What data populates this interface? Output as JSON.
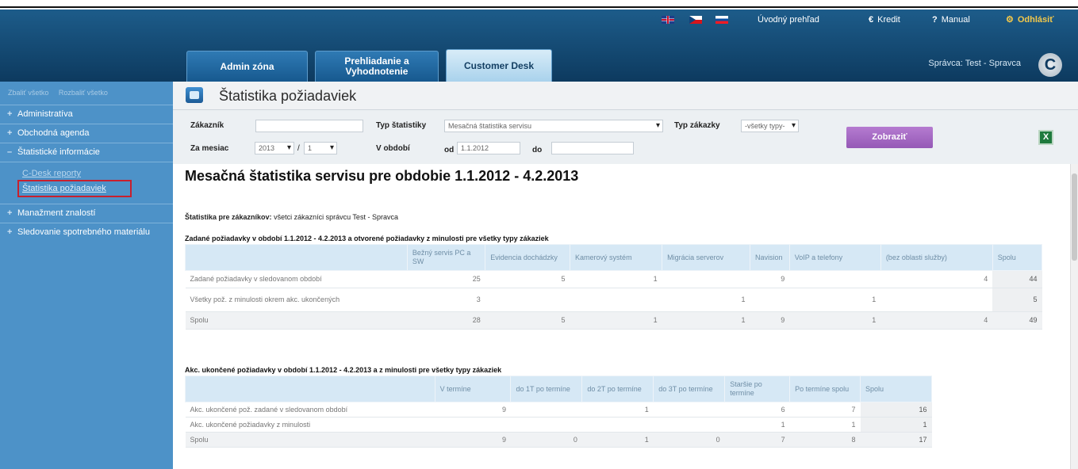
{
  "header": {
    "links": {
      "overview": "Úvodný prehľad",
      "credit": "Kredit",
      "manual": "Manual",
      "logout": "Odhlásiť"
    },
    "link_icons": {
      "credit": "€",
      "manual": "?",
      "logout": "⚙"
    },
    "tabs": [
      {
        "label": "Admin zóna"
      },
      {
        "label": "Prehliadanie a Vyhodnotenie"
      },
      {
        "label": "Customer Desk"
      }
    ],
    "user": "Správca: Test - Spravca",
    "logo": "C"
  },
  "sidebar": {
    "collapse_all": "Zbaliť všetko",
    "expand_all": "Rozbaliť všetko",
    "items": [
      {
        "mark": "+",
        "label": "Administratíva"
      },
      {
        "mark": "+",
        "label": "Obchodná agenda"
      },
      {
        "mark": "–",
        "label": "Štatistické informácie"
      },
      {
        "mark": "+",
        "label": "Manažment znalostí"
      },
      {
        "mark": "+",
        "label": "Sledovanie spotrebného materiálu"
      }
    ],
    "sub_items": [
      "C-Desk reporty",
      "Štatistika požiadaviek"
    ]
  },
  "page": {
    "title": "Štatistika požiadaviek"
  },
  "filters": {
    "customer_label": "Zákazník",
    "customer_value": "",
    "stat_type_label": "Typ štatistiky",
    "stat_type_value": "Mesačná štatistika servisu",
    "order_type_label": "Typ zákazky",
    "order_type_value": "-všetky typy-",
    "month_label": "Za mesiac",
    "year_value": "2013",
    "month_value": "1",
    "period_label": "V období",
    "from_label": "od",
    "from_value": "1.1.2012",
    "to_label": "do",
    "to_value": "",
    "show_button": "Zobraziť",
    "export_icon": "X"
  },
  "report": {
    "title": "Mesačná štatistika servisu pre obdobie 1.1.2012 - 4.2.2013",
    "customer_label": "Štatistika pre zákazníkov:",
    "customer_text": "všetci zákazníci správcu Test - Spravca",
    "table1": {
      "caption": "Zadané požiadavky v období 1.1.2012 - 4.2.2013 a otvorené požiadavky z minulosti pre všetky typy zákaziek",
      "columns": [
        "",
        "Bežný servis PC a SW",
        "Evidencia dochádzky",
        "Kamerový systém",
        "Migrácia serverov",
        "Navision",
        "VoIP a telefony",
        "(bez oblasti služby)",
        "Spolu"
      ],
      "rows": [
        [
          "Zadané požiadavky v sledovanom období",
          "25",
          "5",
          "1",
          "",
          "9",
          "",
          "4",
          "44"
        ],
        [
          "Všetky pož. z minulosti okrem akc. ukončených",
          "3",
          "",
          "",
          "1",
          "",
          "1",
          "",
          "5"
        ],
        [
          "Spolu",
          "28",
          "5",
          "1",
          "1",
          "9",
          "1",
          "4",
          "49"
        ]
      ]
    },
    "table2": {
      "caption": "Akc. ukončené požiadavky v období 1.1.2012 - 4.2.2013 a z minulosti pre všetky typy zákaziek",
      "columns": [
        "",
        "V termíne",
        "do 1T po termíne",
        "do 2T po termíne",
        "do 3T po termíne",
        "Staršie po termíne",
        "Po termíne spolu",
        "Spolu"
      ],
      "rows": [
        [
          "Akc. ukončené pož. zadané v sledovanom období",
          "9",
          "",
          "1",
          "",
          "6",
          "7",
          "16"
        ],
        [
          "Akc. ukončené požiadavky z minulosti",
          "",
          "",
          "",
          "",
          "1",
          "1",
          "1"
        ],
        [
          "Spolu",
          "9",
          "0",
          "1",
          "0",
          "7",
          "8",
          "17"
        ]
      ]
    }
  }
}
